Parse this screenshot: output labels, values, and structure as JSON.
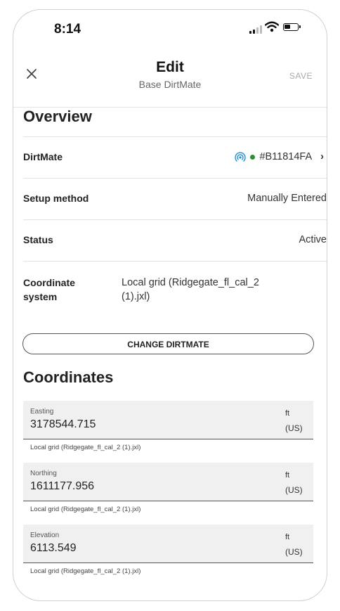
{
  "status_bar": {
    "time": "8:14"
  },
  "header": {
    "title": "Edit",
    "subtitle": "Base DirtMate",
    "save_label": "SAVE"
  },
  "overview": {
    "heading": "Overview",
    "rows": [
      {
        "label": "DirtMate",
        "value": "#B11814FA"
      },
      {
        "label": "Setup method",
        "value": "Manually Entered"
      },
      {
        "label": "Status",
        "value": "Active"
      }
    ],
    "coordinate_system": {
      "label_line1": "Coordinate",
      "label_line2": "system",
      "value_line1": "Local grid (Ridgegate_fl_cal_2",
      "value_line2": "(1).jxl)"
    },
    "change_button": "CHANGE DIRTMATE"
  },
  "coordinates": {
    "heading": "Coordinates",
    "fields": [
      {
        "label": "Easting",
        "value": "3178544.715",
        "unit_line1": "ft",
        "unit_line2": "(US)",
        "helper": "Local grid (Ridgegate_fl_cal_2 (1).jxl)"
      },
      {
        "label": "Northing",
        "value": "1611177.956",
        "unit_line1": "ft",
        "unit_line2": "(US)",
        "helper": "Local grid (Ridgegate_fl_cal_2 (1).jxl)"
      },
      {
        "label": "Elevation",
        "value": "6113.549",
        "unit_line1": "ft",
        "unit_line2": "(US)",
        "helper": "Local grid (Ridgegate_fl_cal_2 (1).jxl)"
      }
    ]
  },
  "icons": {
    "close": "close-icon",
    "signal": "signal-icon",
    "wifi": "wifi-icon",
    "battery": "battery-icon",
    "broadcast": "broadcast-icon",
    "status_dot": "status-dot-icon",
    "chevron": "chevron-right-icon"
  },
  "colors": {
    "status_dot": "#2e8b3a",
    "broadcast_icon": "#1e8fd6",
    "field_bg": "#f0f0f0"
  }
}
